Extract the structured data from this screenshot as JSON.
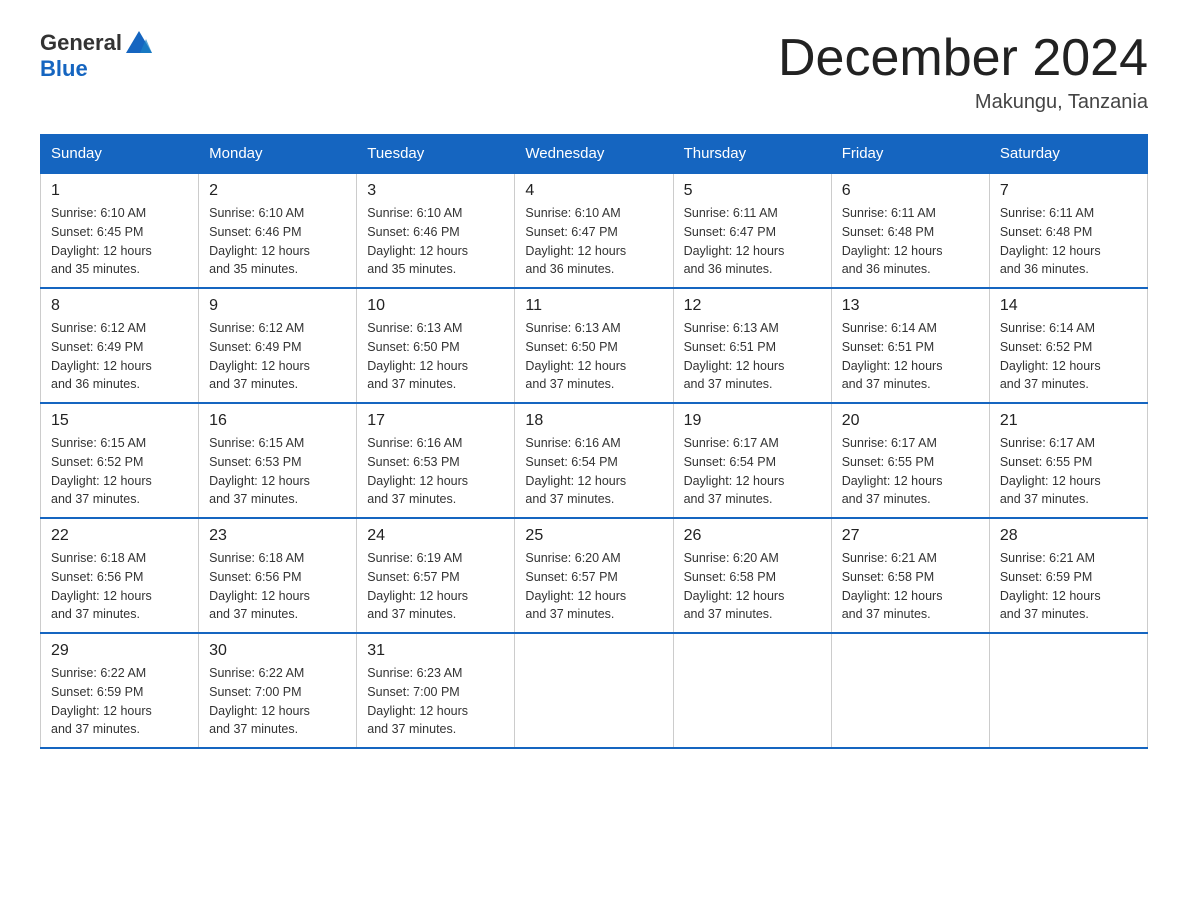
{
  "header": {
    "logo_general": "General",
    "logo_blue": "Blue",
    "title": "December 2024",
    "subtitle": "Makungu, Tanzania"
  },
  "days_of_week": [
    "Sunday",
    "Monday",
    "Tuesday",
    "Wednesday",
    "Thursday",
    "Friday",
    "Saturday"
  ],
  "weeks": [
    [
      {
        "day": "1",
        "sunrise": "6:10 AM",
        "sunset": "6:45 PM",
        "daylight": "12 hours and 35 minutes."
      },
      {
        "day": "2",
        "sunrise": "6:10 AM",
        "sunset": "6:46 PM",
        "daylight": "12 hours and 35 minutes."
      },
      {
        "day": "3",
        "sunrise": "6:10 AM",
        "sunset": "6:46 PM",
        "daylight": "12 hours and 35 minutes."
      },
      {
        "day": "4",
        "sunrise": "6:10 AM",
        "sunset": "6:47 PM",
        "daylight": "12 hours and 36 minutes."
      },
      {
        "day": "5",
        "sunrise": "6:11 AM",
        "sunset": "6:47 PM",
        "daylight": "12 hours and 36 minutes."
      },
      {
        "day": "6",
        "sunrise": "6:11 AM",
        "sunset": "6:48 PM",
        "daylight": "12 hours and 36 minutes."
      },
      {
        "day": "7",
        "sunrise": "6:11 AM",
        "sunset": "6:48 PM",
        "daylight": "12 hours and 36 minutes."
      }
    ],
    [
      {
        "day": "8",
        "sunrise": "6:12 AM",
        "sunset": "6:49 PM",
        "daylight": "12 hours and 36 minutes."
      },
      {
        "day": "9",
        "sunrise": "6:12 AM",
        "sunset": "6:49 PM",
        "daylight": "12 hours and 37 minutes."
      },
      {
        "day": "10",
        "sunrise": "6:13 AM",
        "sunset": "6:50 PM",
        "daylight": "12 hours and 37 minutes."
      },
      {
        "day": "11",
        "sunrise": "6:13 AM",
        "sunset": "6:50 PM",
        "daylight": "12 hours and 37 minutes."
      },
      {
        "day": "12",
        "sunrise": "6:13 AM",
        "sunset": "6:51 PM",
        "daylight": "12 hours and 37 minutes."
      },
      {
        "day": "13",
        "sunrise": "6:14 AM",
        "sunset": "6:51 PM",
        "daylight": "12 hours and 37 minutes."
      },
      {
        "day": "14",
        "sunrise": "6:14 AM",
        "sunset": "6:52 PM",
        "daylight": "12 hours and 37 minutes."
      }
    ],
    [
      {
        "day": "15",
        "sunrise": "6:15 AM",
        "sunset": "6:52 PM",
        "daylight": "12 hours and 37 minutes."
      },
      {
        "day": "16",
        "sunrise": "6:15 AM",
        "sunset": "6:53 PM",
        "daylight": "12 hours and 37 minutes."
      },
      {
        "day": "17",
        "sunrise": "6:16 AM",
        "sunset": "6:53 PM",
        "daylight": "12 hours and 37 minutes."
      },
      {
        "day": "18",
        "sunrise": "6:16 AM",
        "sunset": "6:54 PM",
        "daylight": "12 hours and 37 minutes."
      },
      {
        "day": "19",
        "sunrise": "6:17 AM",
        "sunset": "6:54 PM",
        "daylight": "12 hours and 37 minutes."
      },
      {
        "day": "20",
        "sunrise": "6:17 AM",
        "sunset": "6:55 PM",
        "daylight": "12 hours and 37 minutes."
      },
      {
        "day": "21",
        "sunrise": "6:17 AM",
        "sunset": "6:55 PM",
        "daylight": "12 hours and 37 minutes."
      }
    ],
    [
      {
        "day": "22",
        "sunrise": "6:18 AM",
        "sunset": "6:56 PM",
        "daylight": "12 hours and 37 minutes."
      },
      {
        "day": "23",
        "sunrise": "6:18 AM",
        "sunset": "6:56 PM",
        "daylight": "12 hours and 37 minutes."
      },
      {
        "day": "24",
        "sunrise": "6:19 AM",
        "sunset": "6:57 PM",
        "daylight": "12 hours and 37 minutes."
      },
      {
        "day": "25",
        "sunrise": "6:20 AM",
        "sunset": "6:57 PM",
        "daylight": "12 hours and 37 minutes."
      },
      {
        "day": "26",
        "sunrise": "6:20 AM",
        "sunset": "6:58 PM",
        "daylight": "12 hours and 37 minutes."
      },
      {
        "day": "27",
        "sunrise": "6:21 AM",
        "sunset": "6:58 PM",
        "daylight": "12 hours and 37 minutes."
      },
      {
        "day": "28",
        "sunrise": "6:21 AM",
        "sunset": "6:59 PM",
        "daylight": "12 hours and 37 minutes."
      }
    ],
    [
      {
        "day": "29",
        "sunrise": "6:22 AM",
        "sunset": "6:59 PM",
        "daylight": "12 hours and 37 minutes."
      },
      {
        "day": "30",
        "sunrise": "6:22 AM",
        "sunset": "7:00 PM",
        "daylight": "12 hours and 37 minutes."
      },
      {
        "day": "31",
        "sunrise": "6:23 AM",
        "sunset": "7:00 PM",
        "daylight": "12 hours and 37 minutes."
      },
      null,
      null,
      null,
      null
    ]
  ],
  "labels": {
    "sunrise": "Sunrise:",
    "sunset": "Sunset:",
    "daylight": "Daylight:"
  }
}
